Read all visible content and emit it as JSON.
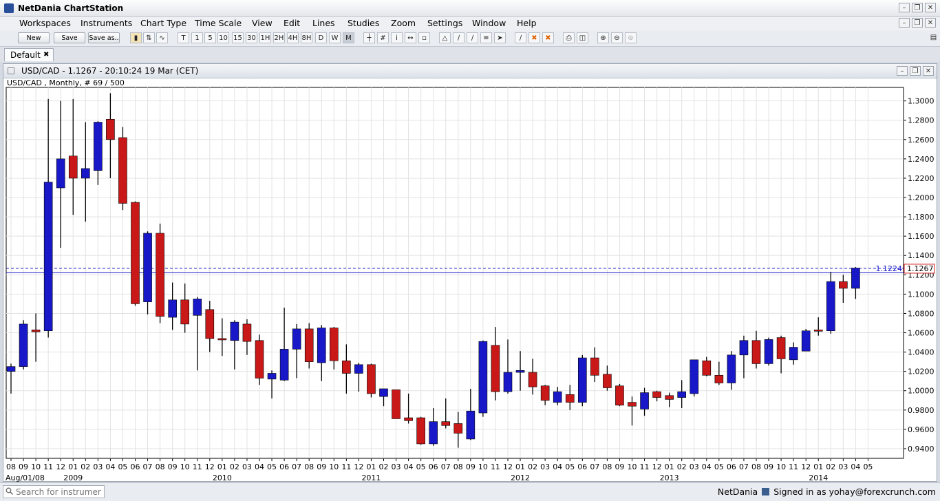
{
  "window": {
    "title": "NetDania ChartStation"
  },
  "menu": [
    "Workspaces",
    "Instruments",
    "Chart Type",
    "Time Scale",
    "View",
    "Edit",
    "Lines",
    "Studies",
    "Zoom",
    "Settings",
    "Window",
    "Help"
  ],
  "toolbar": {
    "new_label": "New",
    "save_label": "Save",
    "saveas_label": "Save as..",
    "timescale": [
      "T",
      "1",
      "5",
      "10",
      "15",
      "30",
      "1H",
      "2H",
      "4H",
      "8H",
      "D",
      "W",
      "M"
    ]
  },
  "tabs": [
    {
      "label": "Default",
      "close": "✖"
    }
  ],
  "chart_window": {
    "title": "USD/CAD - 1.1267 - 20:10:24  19 Mar (CET)",
    "info": "USD/CAD , Monthly, # 69 / 500"
  },
  "chart_data": {
    "type": "candlestick",
    "symbol": "USD/CAD",
    "period": "Monthly",
    "ylim": [
      0.93,
      1.314
    ],
    "yticks": [
      "1.3000",
      "1.2800",
      "1.2600",
      "1.2400",
      "1.2200",
      "1.2000",
      "1.1800",
      "1.1600",
      "1.1400",
      "1.1200",
      "1.1000",
      "1.0800",
      "1.0600",
      "1.0400",
      "1.0200",
      "1.0000",
      "0.9800",
      "0.9600",
      "0.9400"
    ],
    "ytick_values": [
      1.3,
      1.28,
      1.26,
      1.24,
      1.22,
      1.2,
      1.18,
      1.16,
      1.14,
      1.12,
      1.1,
      1.08,
      1.06,
      1.04,
      1.02,
      1.0,
      0.98,
      0.96,
      0.94
    ],
    "month_labels": [
      "08",
      "09",
      "10",
      "11",
      "12",
      "01",
      "02",
      "03",
      "04",
      "05",
      "06",
      "07",
      "08",
      "09",
      "10",
      "11",
      "12",
      "01",
      "02",
      "03",
      "04",
      "05",
      "06",
      "07",
      "08",
      "09",
      "10",
      "11",
      "12",
      "01",
      "02",
      "03",
      "04",
      "05",
      "06",
      "07",
      "08",
      "09",
      "10",
      "11",
      "12",
      "01",
      "02",
      "03",
      "04",
      "05",
      "06",
      "07",
      "08",
      "09",
      "10",
      "11",
      "12",
      "01",
      "02",
      "03",
      "04",
      "05",
      "06",
      "07",
      "08",
      "09",
      "10",
      "11",
      "12",
      "01",
      "02",
      "03",
      "04",
      "05"
    ],
    "year_labels": [
      {
        "label": "Aug/01/08",
        "index": 0
      },
      {
        "label": "2009",
        "index": 5
      },
      {
        "label": "2010",
        "index": 17
      },
      {
        "label": "2011",
        "index": 29
      },
      {
        "label": "2012",
        "index": 41
      },
      {
        "label": "2013",
        "index": 53
      },
      {
        "label": "2014",
        "index": 65
      }
    ],
    "up_color": "#1818c8",
    "down_color": "#c81818",
    "candles": [
      {
        "o": 1.02,
        "h": 1.028,
        "l": 0.997,
        "c": 1.025
      },
      {
        "o": 1.025,
        "h": 1.073,
        "l": 1.022,
        "c": 1.069
      },
      {
        "o": 1.063,
        "h": 1.08,
        "l": 1.03,
        "c": 1.061
      },
      {
        "o": 1.062,
        "h": 1.302,
        "l": 1.055,
        "c": 1.216
      },
      {
        "o": 1.21,
        "h": 1.3,
        "l": 1.148,
        "c": 1.24
      },
      {
        "o": 1.243,
        "h": 1.302,
        "l": 1.182,
        "c": 1.22
      },
      {
        "o": 1.22,
        "h": 1.278,
        "l": 1.175,
        "c": 1.23
      },
      {
        "o": 1.228,
        "h": 1.279,
        "l": 1.213,
        "c": 1.278
      },
      {
        "o": 1.281,
        "h": 1.308,
        "l": 1.22,
        "c": 1.26
      },
      {
        "o": 1.262,
        "h": 1.273,
        "l": 1.187,
        "c": 1.194
      },
      {
        "o": 1.195,
        "h": 1.196,
        "l": 1.088,
        "c": 1.09
      },
      {
        "o": 1.092,
        "h": 1.165,
        "l": 1.079,
        "c": 1.163
      },
      {
        "o": 1.163,
        "h": 1.173,
        "l": 1.07,
        "c": 1.077
      },
      {
        "o": 1.076,
        "h": 1.112,
        "l": 1.063,
        "c": 1.094
      },
      {
        "o": 1.094,
        "h": 1.111,
        "l": 1.06,
        "c": 1.069
      },
      {
        "o": 1.078,
        "h": 1.097,
        "l": 1.021,
        "c": 1.095
      },
      {
        "o": 1.084,
        "h": 1.093,
        "l": 1.04,
        "c": 1.054
      },
      {
        "o": 1.054,
        "h": 1.075,
        "l": 1.036,
        "c": 1.053
      },
      {
        "o": 1.052,
        "h": 1.073,
        "l": 1.022,
        "c": 1.071
      },
      {
        "o": 1.069,
        "h": 1.074,
        "l": 1.037,
        "c": 1.051
      },
      {
        "o": 1.052,
        "h": 1.058,
        "l": 1.006,
        "c": 1.013
      },
      {
        "o": 1.012,
        "h": 1.021,
        "l": 0.992,
        "c": 1.018
      },
      {
        "o": 1.011,
        "h": 1.086,
        "l": 1.01,
        "c": 1.043
      },
      {
        "o": 1.043,
        "h": 1.069,
        "l": 1.013,
        "c": 1.064
      },
      {
        "o": 1.064,
        "h": 1.07,
        "l": 1.023,
        "c": 1.03
      },
      {
        "o": 1.029,
        "h": 1.068,
        "l": 1.01,
        "c": 1.065
      },
      {
        "o": 1.065,
        "h": 1.066,
        "l": 1.022,
        "c": 1.031
      },
      {
        "o": 1.031,
        "h": 1.048,
        "l": 0.997,
        "c": 1.018
      },
      {
        "o": 1.018,
        "h": 1.029,
        "l": 0.999,
        "c": 1.027
      },
      {
        "o": 1.027,
        "h": 1.028,
        "l": 0.993,
        "c": 0.997
      },
      {
        "o": 0.994,
        "h": 1.002,
        "l": 0.984,
        "c": 1.002
      },
      {
        "o": 1.001,
        "h": 1.001,
        "l": 0.971,
        "c": 0.971
      },
      {
        "o": 0.972,
        "h": 0.997,
        "l": 0.966,
        "c": 0.969
      },
      {
        "o": 0.972,
        "h": 0.973,
        "l": 0.944,
        "c": 0.945
      },
      {
        "o": 0.945,
        "h": 0.982,
        "l": 0.943,
        "c": 0.968
      },
      {
        "o": 0.968,
        "h": 0.992,
        "l": 0.961,
        "c": 0.964
      },
      {
        "o": 0.966,
        "h": 0.978,
        "l": 0.941,
        "c": 0.956
      },
      {
        "o": 0.95,
        "h": 1.002,
        "l": 0.949,
        "c": 0.979
      },
      {
        "o": 0.977,
        "h": 1.052,
        "l": 0.973,
        "c": 1.051
      },
      {
        "o": 1.047,
        "h": 1.066,
        "l": 0.99,
        "c": 0.999
      },
      {
        "o": 0.999,
        "h": 1.053,
        "l": 0.997,
        "c": 1.019
      },
      {
        "o": 1.019,
        "h": 1.041,
        "l": 1.0,
        "c": 1.021
      },
      {
        "o": 1.019,
        "h": 1.033,
        "l": 0.996,
        "c": 1.004
      },
      {
        "o": 1.005,
        "h": 1.006,
        "l": 0.985,
        "c": 0.99
      },
      {
        "o": 0.988,
        "h": 1.004,
        "l": 0.985,
        "c": 0.999
      },
      {
        "o": 0.996,
        "h": 1.006,
        "l": 0.98,
        "c": 0.988
      },
      {
        "o": 0.988,
        "h": 1.037,
        "l": 0.984,
        "c": 1.034
      },
      {
        "o": 1.034,
        "h": 1.045,
        "l": 1.009,
        "c": 1.016
      },
      {
        "o": 1.017,
        "h": 1.026,
        "l": 1.0,
        "c": 1.003
      },
      {
        "o": 1.005,
        "h": 1.007,
        "l": 0.984,
        "c": 0.985
      },
      {
        "o": 0.988,
        "h": 0.994,
        "l": 0.964,
        "c": 0.984
      },
      {
        "o": 0.981,
        "h": 1.003,
        "l": 0.974,
        "c": 0.998
      },
      {
        "o": 0.999,
        "h": 1.0,
        "l": 0.989,
        "c": 0.993
      },
      {
        "o": 0.995,
        "h": 0.998,
        "l": 0.983,
        "c": 0.991
      },
      {
        "o": 0.993,
        "h": 1.011,
        "l": 0.982,
        "c": 0.999
      },
      {
        "o": 0.997,
        "h": 1.032,
        "l": 0.994,
        "c": 1.032
      },
      {
        "o": 1.031,
        "h": 1.035,
        "l": 1.015,
        "c": 1.016
      },
      {
        "o": 1.016,
        "h": 1.03,
        "l": 1.006,
        "c": 1.008
      },
      {
        "o": 1.008,
        "h": 1.041,
        "l": 1.001,
        "c": 1.037
      },
      {
        "o": 1.037,
        "h": 1.057,
        "l": 1.013,
        "c": 1.052
      },
      {
        "o": 1.052,
        "h": 1.062,
        "l": 1.023,
        "c": 1.028
      },
      {
        "o": 1.028,
        "h": 1.055,
        "l": 1.026,
        "c": 1.053
      },
      {
        "o": 1.055,
        "h": 1.057,
        "l": 1.018,
        "c": 1.033
      },
      {
        "o": 1.032,
        "h": 1.05,
        "l": 1.027,
        "c": 1.045
      },
      {
        "o": 1.041,
        "h": 1.064,
        "l": 1.041,
        "c": 1.062
      },
      {
        "o": 1.063,
        "h": 1.076,
        "l": 1.057,
        "c": 1.062
      },
      {
        "o": 1.062,
        "h": 1.123,
        "l": 1.059,
        "c": 1.113
      },
      {
        "o": 1.113,
        "h": 1.12,
        "l": 1.091,
        "c": 1.106
      },
      {
        "o": 1.106,
        "h": 1.128,
        "l": 1.095,
        "c": 1.127
      }
    ],
    "hlines": [
      {
        "value": 1.1267,
        "style": "dashed",
        "label": "1.1267",
        "boxed": true
      },
      {
        "value": 1.1224,
        "style": "solid",
        "label": "1.1224",
        "boxed": false
      }
    ]
  },
  "status": {
    "search_placeholder": "Search for instrument",
    "brand": "NetDania",
    "signed_in": "Signed in as yohay@forexcrunch.com"
  }
}
